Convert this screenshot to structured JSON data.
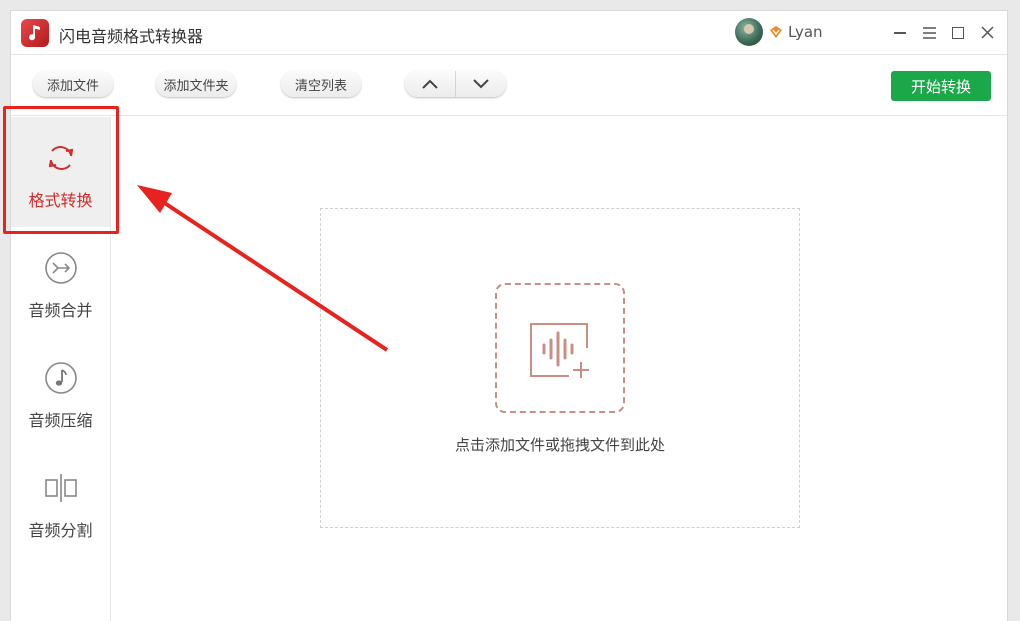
{
  "app": {
    "title": "闪电音频格式转换器",
    "user_name": "Lyan"
  },
  "toolbar": {
    "add_file": "添加文件",
    "add_folder": "添加文件夹",
    "clear_list": "清空列表",
    "start_convert": "开始转换"
  },
  "sidebar": {
    "items": [
      {
        "label": "格式转换",
        "icon": "refresh-icon",
        "active": true
      },
      {
        "label": "音频合并",
        "icon": "merge-icon",
        "active": false
      },
      {
        "label": "音频压缩",
        "icon": "music-note-icon",
        "active": false
      },
      {
        "label": "音频分割",
        "icon": "split-icon",
        "active": false
      }
    ]
  },
  "dropzone": {
    "hint": "点击添加文件或拖拽文件到此处"
  },
  "colors": {
    "accent_green": "#1aa84a",
    "active_red": "#d42a2a",
    "annotation_red": "#e8231f",
    "drop_icon": "#c98e84"
  }
}
